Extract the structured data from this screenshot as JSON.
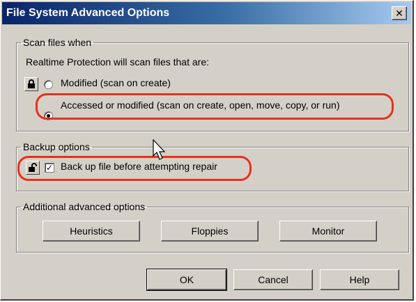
{
  "window": {
    "title": "File System Advanced Options",
    "close_label": "✕"
  },
  "scan_group": {
    "legend": "Scan files when",
    "description": "Realtime Protection will scan files that are:",
    "options": [
      {
        "label": "Modified (scan on create)",
        "checked": false,
        "locked": true
      },
      {
        "label": "Accessed or modified (scan on create, open, move, copy, or run)",
        "checked": true,
        "locked": false
      }
    ]
  },
  "backup_group": {
    "legend": "Backup options",
    "checkbox_label": "Back up file before attempting repair",
    "checked": true,
    "locked": false
  },
  "advanced_group": {
    "legend": "Additional advanced options",
    "buttons": [
      "Heuristics",
      "Floppies",
      "Monitor"
    ]
  },
  "footer": {
    "ok_label": "OK",
    "cancel_label": "Cancel",
    "help_label": "Help"
  },
  "colors": {
    "title_bar_start": "#0a246a",
    "title_bar_end": "#a6caf0",
    "highlight": "#e8301c",
    "dialog_face": "#d4d0c8"
  },
  "icons": {
    "locked": "padlock-closed-icon",
    "unlocked": "padlock-open-icon",
    "pointer": "mouse-pointer-icon"
  }
}
